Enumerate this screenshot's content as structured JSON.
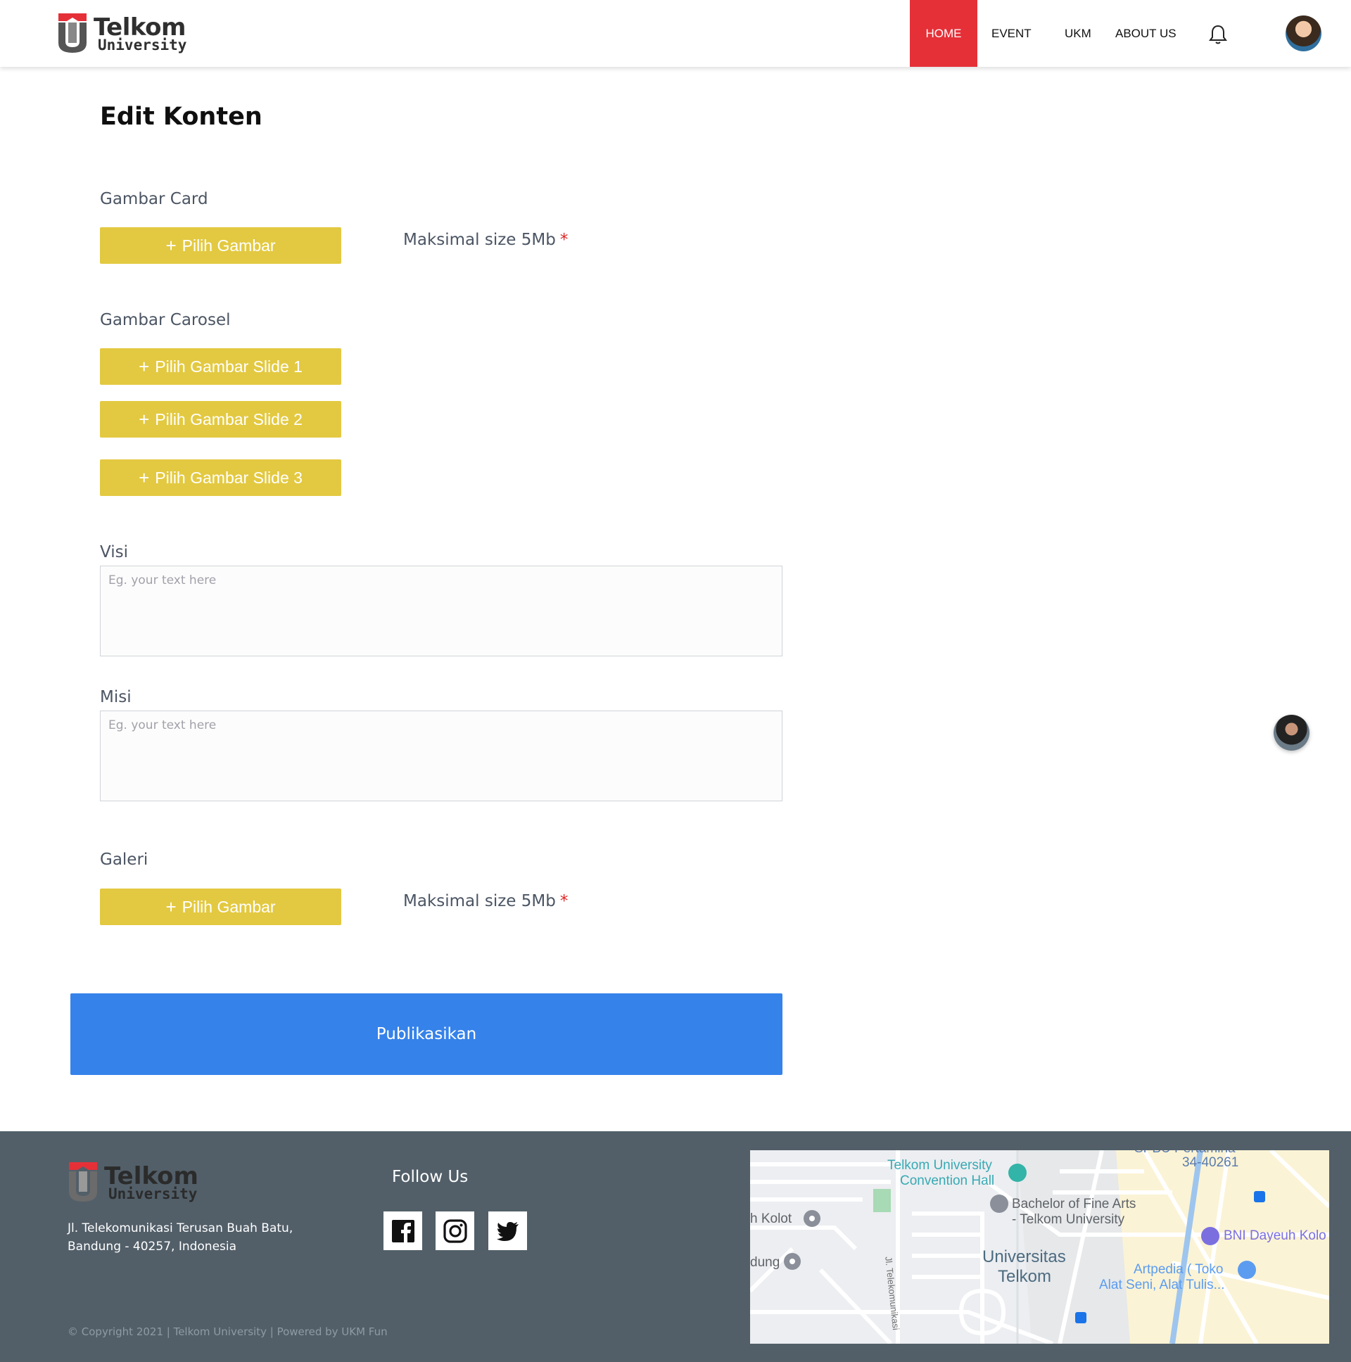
{
  "header": {
    "logo_word1": "Telkom",
    "logo_word2": "University",
    "nav": {
      "home": "HOME",
      "event": "EVENT",
      "ukm": "UKM",
      "about": "ABOUT US"
    },
    "icons": {
      "notification": "bell-icon",
      "profile": "user-avatar"
    }
  },
  "main": {
    "title": "Edit Konten",
    "gambar_card": {
      "label": "Gambar Card",
      "button": "Pilih Gambar",
      "hint": "Maksimal size 5Mb",
      "required_mark": "*"
    },
    "gambar_carosel": {
      "label": "Gambar Carosel",
      "buttons": [
        "Pilih Gambar Slide 1",
        "Pilih Gambar Slide 2",
        "Pilih Gambar Slide 3"
      ]
    },
    "visi": {
      "label": "Visi",
      "placeholder": "Eg. your text here"
    },
    "misi": {
      "label": "Misi",
      "placeholder": "Eg. your text here"
    },
    "galeri": {
      "label": "Galeri",
      "button": "Pilih Gambar",
      "hint": "Maksimal size 5Mb",
      "required_mark": "*"
    },
    "publish_button": "Publikasikan",
    "plus_glyph": "+"
  },
  "footer": {
    "logo_word1": "Telkom",
    "logo_word2": "University",
    "address_line1": "Jl. Telekomunikasi Terusan Buah Batu,",
    "address_line2": "Bandung - 40257, Indonesia",
    "follow_us": "Follow Us",
    "social": [
      "facebook-icon",
      "instagram-icon",
      "twitter-icon"
    ],
    "copyright": "© Copyright 2021  |  Telkom University | Powered by UKM Fun",
    "map_labels": {
      "convention_line1": "Telkom University",
      "convention_line2": "Convention Hall",
      "fine_arts_line1": "Bachelor of Fine Arts",
      "fine_arts_line2": "- Telkom University",
      "kolot": "h Kolot",
      "dung": "dung",
      "jalan": "Jl. Telekomunikasi",
      "univ_line1": "Universitas",
      "univ_line2": "Telkom",
      "bni": "BNI Dayeuh Kolo",
      "artpedia_line1": "Artpedia ( Toko",
      "artpedia_line2": "Alat Seni, Alat Tulis...",
      "postal": "34-40261",
      "spbu": "SPBU Pertamina"
    }
  },
  "colors": {
    "accent_red": "#e53038",
    "button_yellow": "#e3c941",
    "publish_blue": "#3582ea",
    "footer_bg": "#525f69"
  }
}
